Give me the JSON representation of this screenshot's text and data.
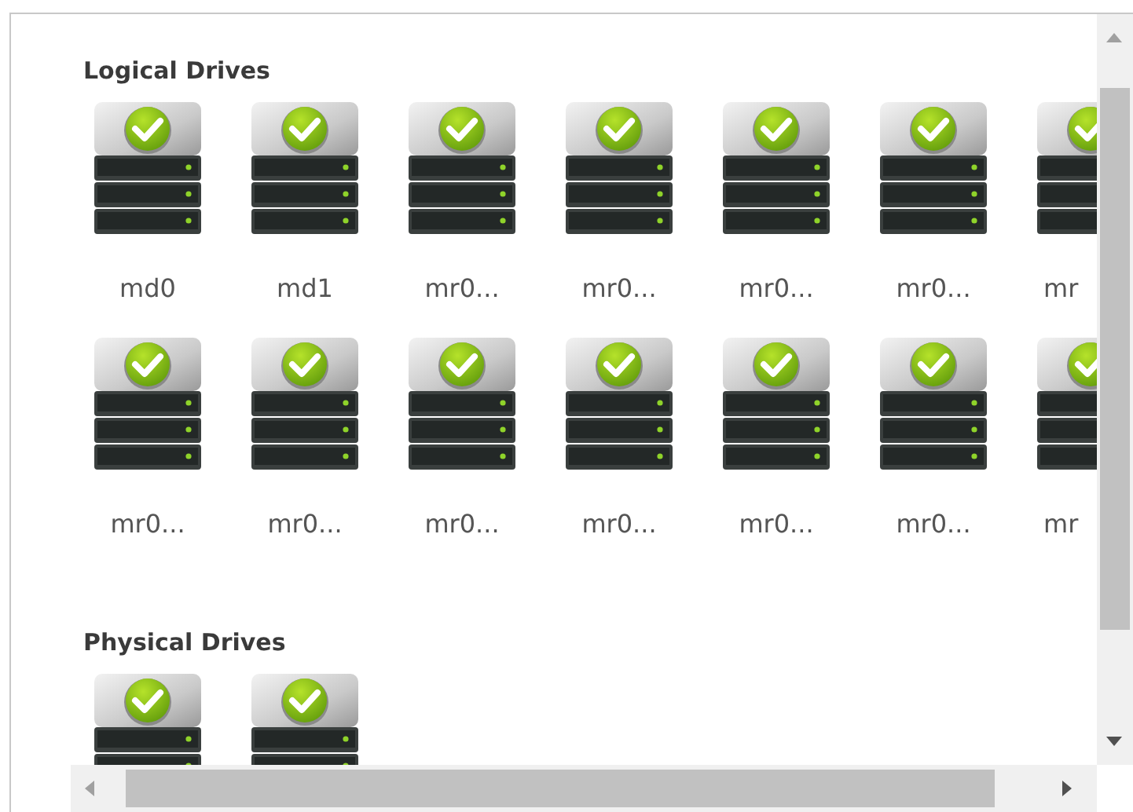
{
  "sections": [
    {
      "title": "Logical Drives",
      "rows": [
        [
          {
            "label": "md0",
            "kind": "healthy"
          },
          {
            "label": "md1",
            "kind": "healthy"
          },
          {
            "label": "mr0...",
            "kind": "healthy"
          },
          {
            "label": "mr0...",
            "kind": "healthy"
          },
          {
            "label": "mr0...",
            "kind": "healthy"
          },
          {
            "label": "mr0...",
            "kind": "healthy"
          },
          {
            "label": "mr",
            "kind": "healthy"
          }
        ],
        [
          {
            "label": "mr0...",
            "kind": "healthy"
          },
          {
            "label": "mr0...",
            "kind": "healthy"
          },
          {
            "label": "mr0...",
            "kind": "healthy"
          },
          {
            "label": "mr0...",
            "kind": "healthy"
          },
          {
            "label": "mr0...",
            "kind": "healthy"
          },
          {
            "label": "mr0...",
            "kind": "healthy"
          },
          {
            "label": "mr",
            "kind": "healthy"
          }
        ]
      ]
    },
    {
      "title": "Physical Drives",
      "rows": [
        [
          {
            "kind": "healthy"
          },
          {
            "kind": "healthy"
          }
        ]
      ]
    }
  ]
}
